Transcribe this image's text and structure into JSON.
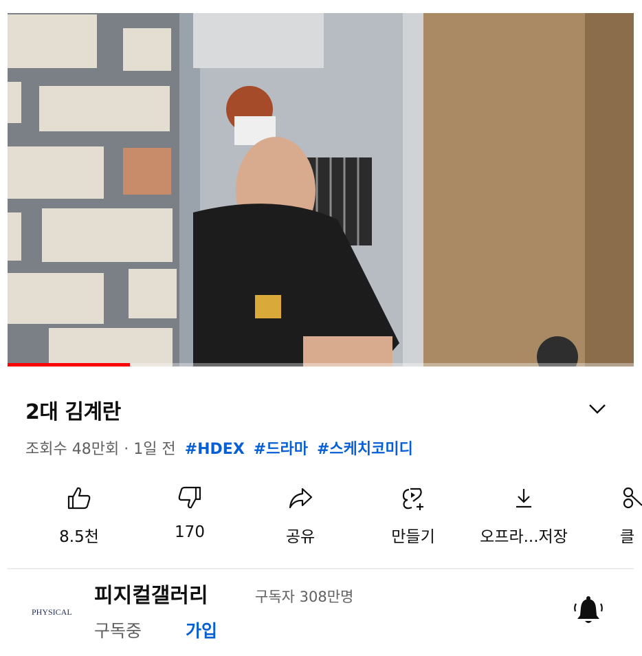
{
  "player": {
    "progress_fraction": 0.195
  },
  "video": {
    "title": "2대 김계란",
    "views": "조회수 48만회",
    "separator": "·",
    "age": "1일 전",
    "hashtags": [
      "#HDEX",
      "#드라마",
      "#스케치코미디"
    ]
  },
  "actions": {
    "like": "8.5천",
    "dislike": "170",
    "share": "공유",
    "remix": "만들기",
    "download": "오프라...저장",
    "clip": "클"
  },
  "channel": {
    "name": "피지컬갤러리",
    "subscribers": "구독자 308만명",
    "subscribed_label": "구독중",
    "join_label": "가입",
    "logo_text": "PHYSICAL"
  },
  "colors": {
    "link": "#065fd4",
    "progress": "#ff0000",
    "secondary_text": "#606060"
  },
  "icons": [
    "thumbs-up-icon",
    "thumbs-down-icon",
    "share-icon",
    "remix-icon",
    "download-icon",
    "clip-icon",
    "chevron-down-icon",
    "bell-icon"
  ]
}
